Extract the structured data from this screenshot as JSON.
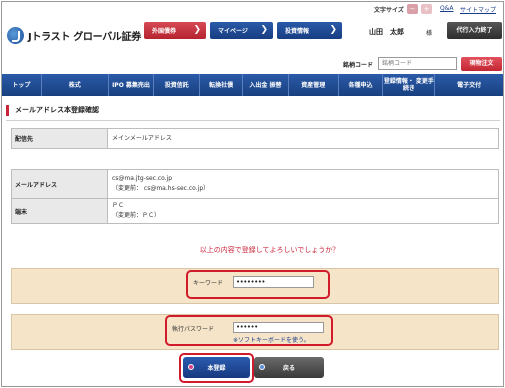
{
  "util": {
    "font_size_label": "文字サイズ",
    "font_minus": "−",
    "font_plus": "+",
    "qa_link": "Q&A",
    "sitemap_link": "サイトマップ"
  },
  "header": {
    "logo_text": "Jトラスト グローバル証券",
    "foreign_stock": "外国債券",
    "mypage": "マイページ",
    "investment_info": "投資情報",
    "chevron": "❯",
    "user_name": "山田　太郎",
    "honorific": "様",
    "proxy_button": "代行入力終了"
  },
  "search": {
    "code_label": "銘柄コード",
    "code_placeholder": "銘柄コード",
    "spot_order": "現物注文"
  },
  "mainnav": [
    {
      "label": "トップ",
      "w": 40
    },
    {
      "label": "株式",
      "w": 67
    },
    {
      "label": "IPO 募集売出",
      "w": 46
    },
    {
      "label": "投資信託",
      "w": 46
    },
    {
      "label": "転換社債",
      "w": 43
    },
    {
      "label": "入出金 振替",
      "w": 46
    },
    {
      "label": "資産管理",
      "w": 50
    },
    {
      "label": "各種申込",
      "w": 45
    },
    {
      "label": "登録情報・ 変更手続き",
      "w": 52
    },
    {
      "label": "電子交付",
      "w": 68
    }
  ],
  "page": {
    "title": "メールアドレス本登録確認"
  },
  "delivery": {
    "label": "配信先",
    "value": "メインメールアドレス"
  },
  "details": {
    "email_label": "メールアドレス",
    "email_value": "cs@ma.jtg-sec.co.jp",
    "email_before": "（変更前： cs@ma.hs-sec.co.jp）",
    "device_label": "端末",
    "device_value": "ＰＣ",
    "device_before": "（変更前：ＰＣ）"
  },
  "confirm_question": "以上の内容で登録してよろしいでしょうか？",
  "auth": {
    "keyword_label": "キーワード",
    "keyword_value": "••••••••",
    "exec_password_label": "執行パスワード",
    "exec_password_value": "••••••",
    "soft_keyboard": "※ソフトキーボードを使う。"
  },
  "actions": {
    "register": "本登録",
    "back": "戻る"
  }
}
